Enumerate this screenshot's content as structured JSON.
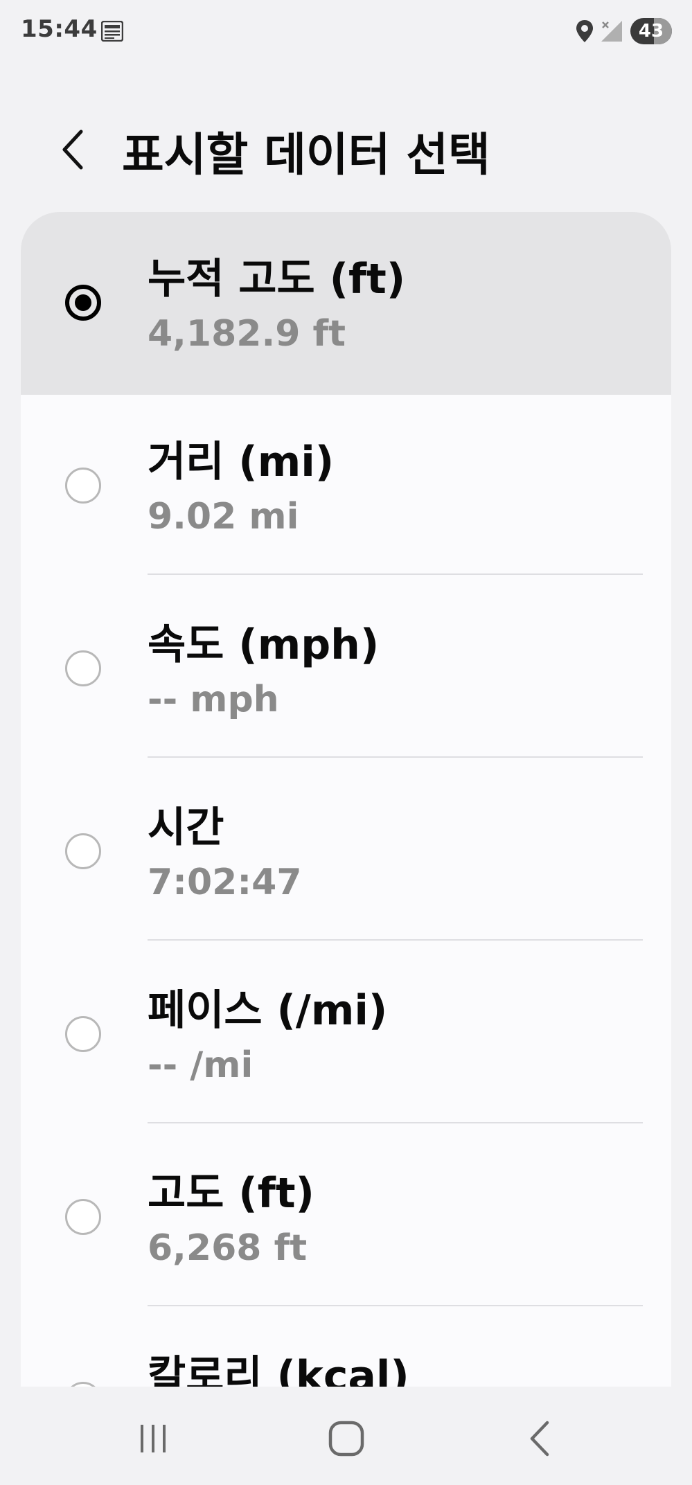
{
  "status_bar": {
    "time": "15:44",
    "battery": "43"
  },
  "header": {
    "title": "표시할 데이터 선택"
  },
  "items": [
    {
      "title": "누적 고도 (ft)",
      "value": "4,182.9 ft",
      "selected": true
    },
    {
      "title": "거리 (mi)",
      "value": "9.02 mi",
      "selected": false
    },
    {
      "title": "속도 (mph)",
      "value": "-- mph",
      "selected": false
    },
    {
      "title": "시간",
      "value": "7:02:47",
      "selected": false
    },
    {
      "title": "페이스 (/mi)",
      "value": "-- /mi",
      "selected": false
    },
    {
      "title": "고도 (ft)",
      "value": "6,268 ft",
      "selected": false
    },
    {
      "title": "칼로리 (kcal)",
      "value": "",
      "selected": false
    }
  ],
  "icons": {
    "back": "chevron-left-icon",
    "nav_recents": "recents-icon",
    "nav_home": "home-icon",
    "nav_back": "back-icon"
  },
  "colors": {
    "background": "#f2f2f4",
    "card": "#fbfbfd",
    "selected_row": "#e4e4e6",
    "secondary_text": "#8a8a8a"
  }
}
